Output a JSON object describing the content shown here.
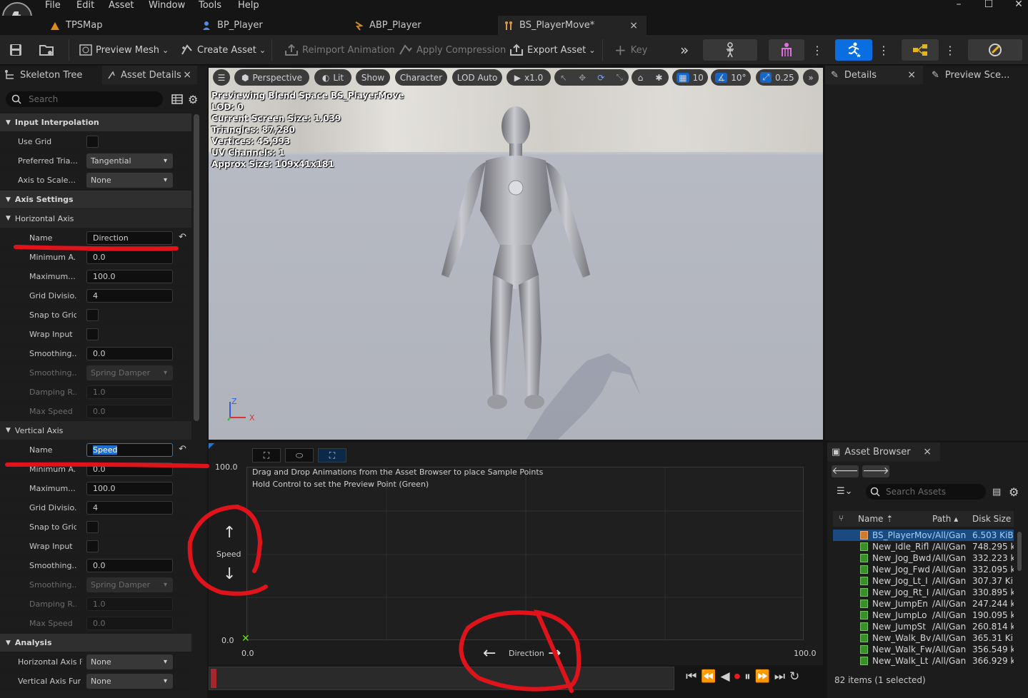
{
  "menu": [
    "File",
    "Edit",
    "Asset",
    "Window",
    "Tools",
    "Help"
  ],
  "window_controls": {
    "minimize": "–",
    "maximize": "☐",
    "close": "✕"
  },
  "doc_tabs": [
    {
      "label": "TPSMap"
    },
    {
      "label": "BP_Player"
    },
    {
      "label": "ABP_Player"
    },
    {
      "label": "BS_PlayerMove*",
      "close": "×"
    }
  ],
  "toolbar": {
    "preview_mesh": "Preview Mesh",
    "create_asset": "Create Asset",
    "reimport_animation": "Reimport Animation",
    "apply_compression": "Apply Compression",
    "export_asset": "Export Asset",
    "key": "Key"
  },
  "left_panel": {
    "tabs": [
      "Skeleton Tree",
      "Asset Details"
    ],
    "close": "×",
    "search_placeholder": "Search",
    "input_interpolation": {
      "header": "Input Interpolation",
      "use_grid": "Use Grid",
      "preferred_triangulation": "Preferred Tria...",
      "preferred_triangulation_value": "Tangential",
      "axis_to_scale": "Axis to Scale...",
      "axis_to_scale_value": "None"
    },
    "axis_settings": {
      "header": "Axis Settings",
      "horizontal": {
        "header": "Horizontal Axis",
        "name_label": "Name",
        "name_value": "Direction",
        "min_label": "Minimum A...",
        "min_value": "0.0",
        "max_label": "Maximum...",
        "max_value": "100.0",
        "grid_label": "Grid Divisio...",
        "grid_value": "4",
        "snap_label": "Snap to Grid",
        "wrap_label": "Wrap Input",
        "smoothing_time_label": "Smoothing...",
        "smoothing_time_value": "0.0",
        "smoothing_type_label": "Smoothing...",
        "smoothing_type_value": "Spring Damper",
        "damping_label": "Damping R...",
        "damping_value": "1.0",
        "maxspeed_label": "Max Speed",
        "maxspeed_value": "0.0"
      },
      "vertical": {
        "header": "Vertical Axis",
        "name_label": "Name",
        "name_value": "Speed",
        "min_label": "Minimum A...",
        "min_value": "0.0",
        "max_label": "Maximum...",
        "max_value": "100.0",
        "grid_label": "Grid Divisio...",
        "grid_value": "4",
        "snap_label": "Snap to Grid",
        "wrap_label": "Wrap Input",
        "smoothing_time_label": "Smoothing...",
        "smoothing_time_value": "0.0",
        "smoothing_type_label": "Smoothing...",
        "smoothing_type_value": "Spring Damper",
        "damping_label": "Damping R...",
        "damping_value": "1.0",
        "maxspeed_label": "Max Speed",
        "maxspeed_value": "0.0"
      }
    },
    "analysis": {
      "header": "Analysis",
      "horizontal_label": "Horizontal Axis F",
      "horizontal_value": "None",
      "vertical_label": "Vertical Axis Fur",
      "vertical_value": "None"
    }
  },
  "viewport": {
    "toolbar": {
      "perspective": "Perspective",
      "lit": "Lit",
      "show": "Show",
      "character": "Character",
      "lod": "LOD Auto",
      "speed": "x1.0",
      "grid_snap": "10",
      "rotation_snap": "10°",
      "scale_snap": "0.25"
    },
    "overlay": [
      "Previewing Blend Space BS_PlayerMove",
      "LOD: 0",
      "Current Screen Size: 1.039",
      "Triangles: 87,280",
      "Vertices: 45,993",
      "UV Channels: 1",
      "Approx Size: 109x41x181"
    ],
    "axes": {
      "z": "Z",
      "x": "X"
    }
  },
  "blend_space": {
    "hint_line1": "Drag and Drop Animations from the Asset Browser to place Sample Points",
    "hint_line2": "Hold Control to set the Preview Point (Green)",
    "y_max": "100.0",
    "y_min": "0.0",
    "x_min": "0.0",
    "x_max": "100.0",
    "y_axis_label": "Speed",
    "x_axis_label": "Direction",
    "preview_marker": "✕"
  },
  "details": {
    "tabs": [
      "Details",
      "Preview Sce..."
    ],
    "close": "×"
  },
  "asset_browser": {
    "tab": "Asset Browser",
    "close": "×",
    "search_placeholder": "Search Assets",
    "columns": {
      "name": "Name",
      "path": "Path",
      "size": "Disk Size"
    },
    "rows": [
      {
        "name": "BS_PlayerMov",
        "path": "/All/Gan",
        "size": "6.503 KiB",
        "selected": true
      },
      {
        "name": "New_Idle_Rifl",
        "path": "/All/Gan",
        "size": "748.295 k"
      },
      {
        "name": "New_Jog_Bwd",
        "path": "/All/Gan",
        "size": "332.223 k"
      },
      {
        "name": "New_Jog_Fwd",
        "path": "/All/Gan",
        "size": "332.095 k"
      },
      {
        "name": "New_Jog_Lt_I",
        "path": "/All/Gan",
        "size": "307.37 Ki"
      },
      {
        "name": "New_Jog_Rt_I",
        "path": "/All/Gan",
        "size": "330.895 k"
      },
      {
        "name": "New_JumpEn",
        "path": "/All/Gan",
        "size": "247.244 k"
      },
      {
        "name": "New_JumpLo",
        "path": "/All/Gan",
        "size": "190.095 k"
      },
      {
        "name": "New_JumpSt",
        "path": "/All/Gan",
        "size": "260.814 k"
      },
      {
        "name": "New_Walk_Bv",
        "path": "/All/Gan",
        "size": "365.31 Ki"
      },
      {
        "name": "New_Walk_Fw",
        "path": "/All/Gan",
        "size": "356.549 k"
      },
      {
        "name": "New_Walk_Lt",
        "path": "/All/Gan",
        "size": "366.929 k"
      }
    ],
    "status": "82 items (1 selected)"
  },
  "colors": {
    "accent_blue": "#0a6ee0",
    "annotation_red": "#e0131b",
    "selection": "#1b4a80"
  }
}
